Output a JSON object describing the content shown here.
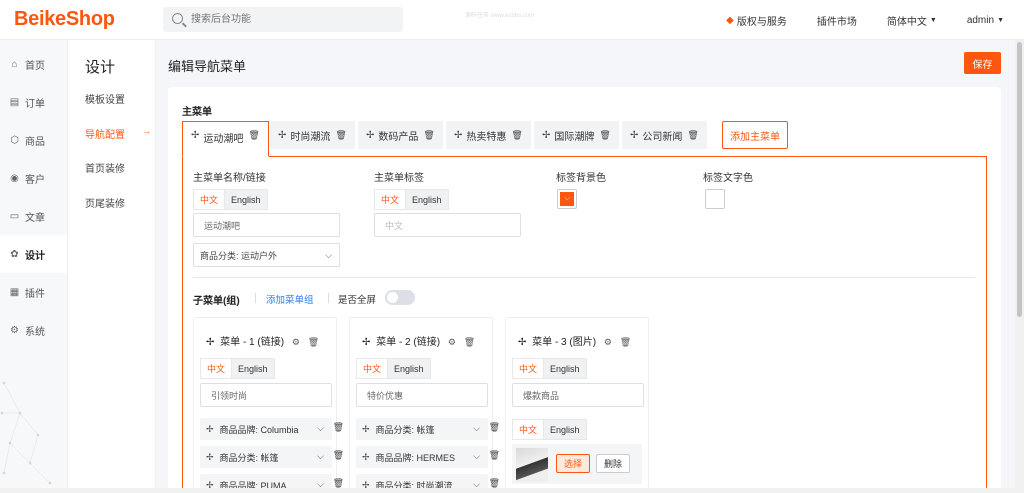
{
  "app": {
    "logo": "BeikeShop"
  },
  "search": {
    "placeholder": "搜索后台功能"
  },
  "watermark": "源码任务 www.ecbbs.com",
  "topnav": {
    "license": "版权与服务",
    "plugin_market": "插件市场",
    "language": "简体中文",
    "user": "admin"
  },
  "sidebar": {
    "items": [
      {
        "label": "首页",
        "icon": "home-icon"
      },
      {
        "label": "订单",
        "icon": "order-icon"
      },
      {
        "label": "商品",
        "icon": "box-icon"
      },
      {
        "label": "客户",
        "icon": "user-icon"
      },
      {
        "label": "文章",
        "icon": "article-icon"
      },
      {
        "label": "设计",
        "icon": "palette-icon"
      },
      {
        "label": "插件",
        "icon": "plugin-icon"
      },
      {
        "label": "系统",
        "icon": "gear-icon"
      }
    ],
    "active_index": 5
  },
  "submenu": {
    "title": "设计",
    "items": [
      "模板设置",
      "导航配置",
      "首页装修",
      "页尾装修"
    ],
    "active_index": 1
  },
  "page": {
    "title": "编辑导航菜单",
    "save_label": "保存"
  },
  "main_menu": {
    "heading": "主菜单",
    "tabs": [
      "运动潮吧",
      "时尚潮流",
      "数码产品",
      "热卖特惠",
      "国际潮牌",
      "公司新闻"
    ],
    "active_tab": 0,
    "add_label": "添加主菜单"
  },
  "editor": {
    "name_link_label": "主菜单名称/链接",
    "tag_label": "主菜单标签",
    "tag_bg_label": "标签背景色",
    "tag_text_color_label": "标签文字色",
    "lang_zh": "中文",
    "lang_en": "English",
    "name_value": "运动潮吧",
    "link_value": "商品分类: 运动户外",
    "tag_placeholder": "中文",
    "tag_bg_color": "#fd560f",
    "tag_text_color": "#ffffff"
  },
  "submenus": {
    "heading": "子菜单(组)",
    "add_label": "添加菜单组",
    "fullscreen_label": "是否全屏",
    "fullscreen": false,
    "groups": [
      {
        "title": "菜单 - 1 (链接)",
        "name": "引领时尚",
        "rows": [
          "商品品牌: Columbia",
          "商品分类: 帐篷",
          "商品品牌: PUMA"
        ]
      },
      {
        "title": "菜单 - 2 (链接)",
        "name": "特价优惠",
        "rows": [
          "商品分类: 帐篷",
          "商品品牌: HERMES",
          "商品分类: 时尚潮流"
        ]
      },
      {
        "title": "菜单 - 3 (图片)",
        "name": "爆款商品",
        "select_label": "选择",
        "delete_label": "删除"
      }
    ]
  },
  "colors": {
    "accent": "#fd560f",
    "link": "#2f7cf6"
  }
}
